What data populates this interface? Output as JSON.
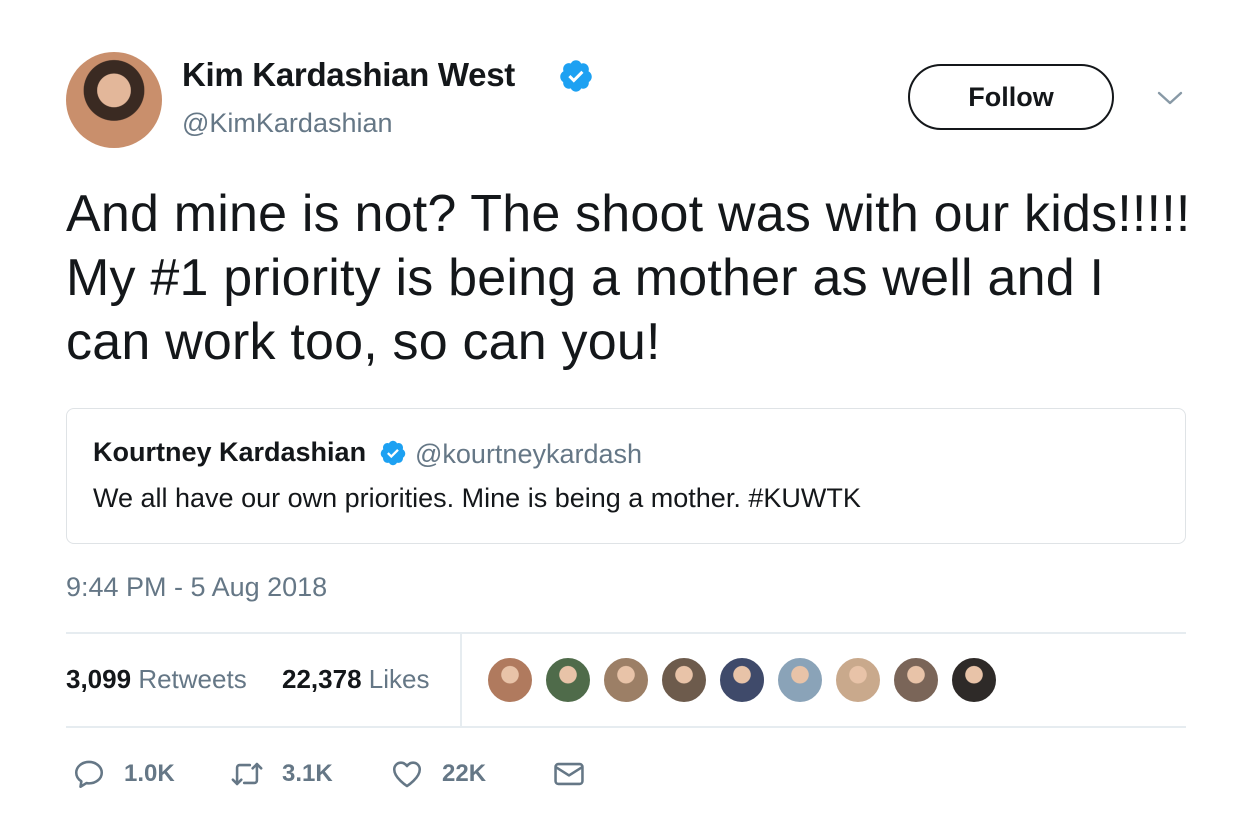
{
  "author": {
    "name": "Kim Kardashian West",
    "handle": "@KimKardashian"
  },
  "follow_label": "Follow",
  "tweet_text": "And mine is not? The shoot was with our kids!!!!! My #1 priority is being a mother as well and I can work too, so can you!",
  "quoted_tweet": {
    "name": "Kourtney Kardashian",
    "handle": "@kourtneykardash",
    "text": "We all have our own priorities. Mine is being a mother. #KUWTK"
  },
  "timestamp": "9:44 PM - 5 Aug 2018",
  "stats": {
    "retweets_count": "3,099",
    "retweets_label": "Retweets",
    "likes_count": "22,378",
    "likes_label": "Likes"
  },
  "liker_avatars": [
    {
      "color": "#b07a5e"
    },
    {
      "color": "#4f6b4a"
    },
    {
      "color": "#9c7f66"
    },
    {
      "color": "#6d5b4c"
    },
    {
      "color": "#3f4a6a"
    },
    {
      "color": "#8aa3b8"
    },
    {
      "color": "#c9a98c"
    },
    {
      "color": "#7a6558"
    },
    {
      "color": "#2e2a28"
    }
  ],
  "actions": {
    "replies": "1.0K",
    "retweets": "3.1K",
    "likes": "22K"
  },
  "icons": [
    "verified-icon",
    "chevron-down-icon",
    "reply-icon",
    "retweet-icon",
    "heart-icon",
    "mail-icon"
  ],
  "colors": {
    "verified": "#1da1f2",
    "muted": "#657786",
    "text": "#14171a",
    "border": "#e6ecf0"
  }
}
